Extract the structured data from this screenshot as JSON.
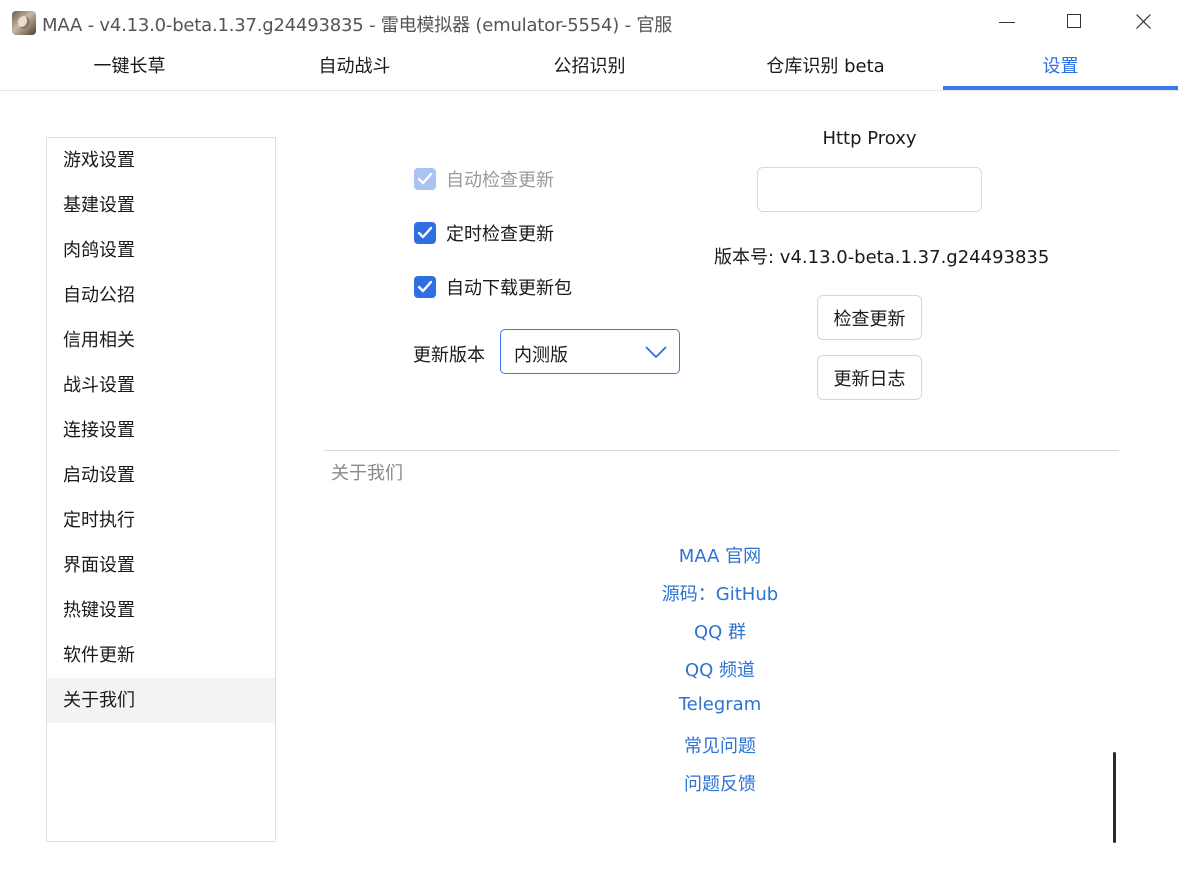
{
  "window": {
    "title": "MAA - v4.13.0-beta.1.37.g24493835 - 雷电模拟器 (emulator-5554) - 官服",
    "icon": "app-avatar-icon"
  },
  "tabs": [
    {
      "label": "一键长草"
    },
    {
      "label": "自动战斗"
    },
    {
      "label": "公招识别"
    },
    {
      "label": "仓库识别 beta"
    },
    {
      "label": "设置",
      "active": true
    }
  ],
  "sidebar": {
    "items": [
      {
        "label": "游戏设置"
      },
      {
        "label": "基建设置"
      },
      {
        "label": "肉鸽设置"
      },
      {
        "label": "自动公招"
      },
      {
        "label": "信用相关"
      },
      {
        "label": "战斗设置"
      },
      {
        "label": "连接设置"
      },
      {
        "label": "启动设置"
      },
      {
        "label": "定时执行"
      },
      {
        "label": "界面设置"
      },
      {
        "label": "热键设置"
      },
      {
        "label": "软件更新"
      },
      {
        "label": "关于我们",
        "selected": true
      }
    ]
  },
  "update": {
    "auto_check": {
      "label": "自动检查更新",
      "checked": true,
      "disabled": true
    },
    "scheduled_check": {
      "label": "定时检查更新",
      "checked": true
    },
    "auto_download": {
      "label": "自动下载更新包",
      "checked": true
    },
    "channel_label": "更新版本",
    "channel_value": "内测版",
    "proxy_label": "Http Proxy",
    "proxy_value": "",
    "version_text": "版本号: v4.13.0-beta.1.37.g24493835",
    "check_button": "检查更新",
    "changelog_button": "更新日志"
  },
  "about": {
    "title": "关于我们",
    "links": [
      {
        "label": "MAA 官网"
      },
      {
        "label": "源码：GitHub"
      },
      {
        "label": "QQ 群"
      },
      {
        "label": "QQ 频道"
      },
      {
        "label": "Telegram"
      },
      {
        "label": "常见问题"
      },
      {
        "label": "问题反馈"
      }
    ]
  },
  "colors": {
    "accent": "#2f6fe4",
    "link": "#2e72d2",
    "muted": "#8a8a8a"
  }
}
